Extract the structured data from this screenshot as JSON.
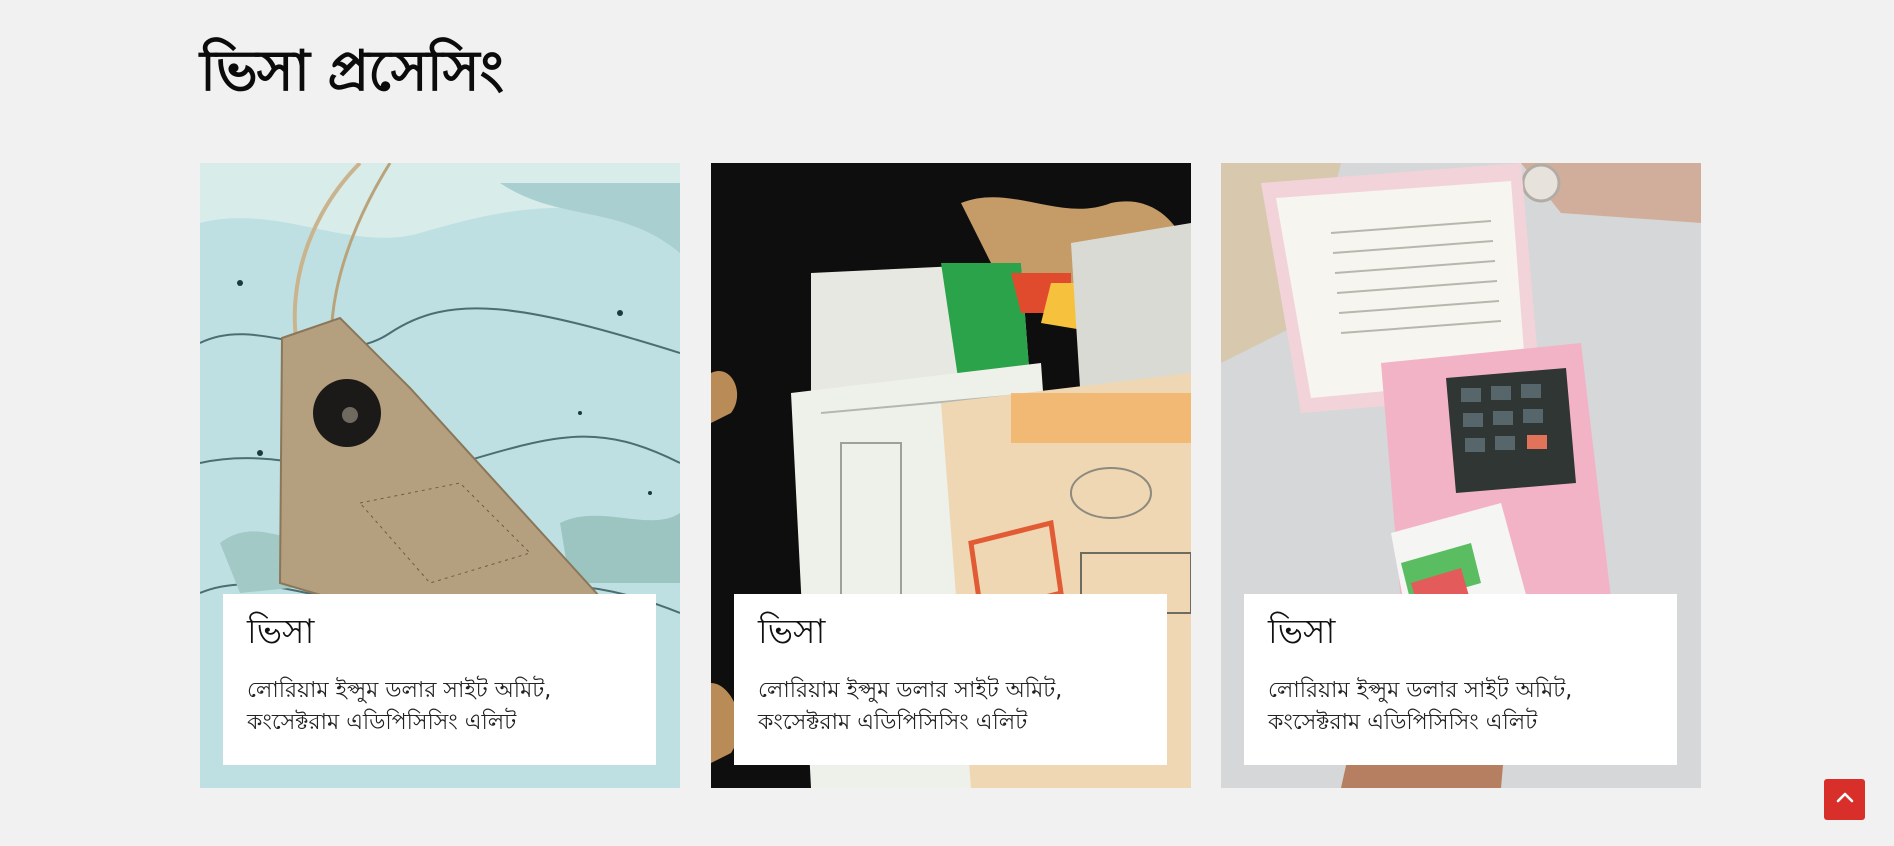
{
  "section": {
    "title": "ভিসা প্রসেসিং"
  },
  "cards": [
    {
      "title": "ভিসা",
      "text": "লোরিয়াম ইপ্সুম ডলার সাইট অমিট, কংসেক্টরাম এডিপিসিসিং এলিট",
      "image": "luggage-tag-on-world-map"
    },
    {
      "title": "ভিসা",
      "text": "লোরিয়াম ইপ্সুম ডলার সাইট অমিট, কংসেক্টরাম এডিপিসিসিং এলিট",
      "image": "passport-visa-stamps-and-maps"
    },
    {
      "title": "ভিসা",
      "text": "লোরিয়াম ইপ্সুম ডলার সাইট অমিট, কংসেক্টরাম এডিপিসিসিং এলিট",
      "image": "card-payment-terminal"
    }
  ],
  "back_to_top": {
    "icon": "chevron-up-icon",
    "color": "#d92f2b"
  }
}
